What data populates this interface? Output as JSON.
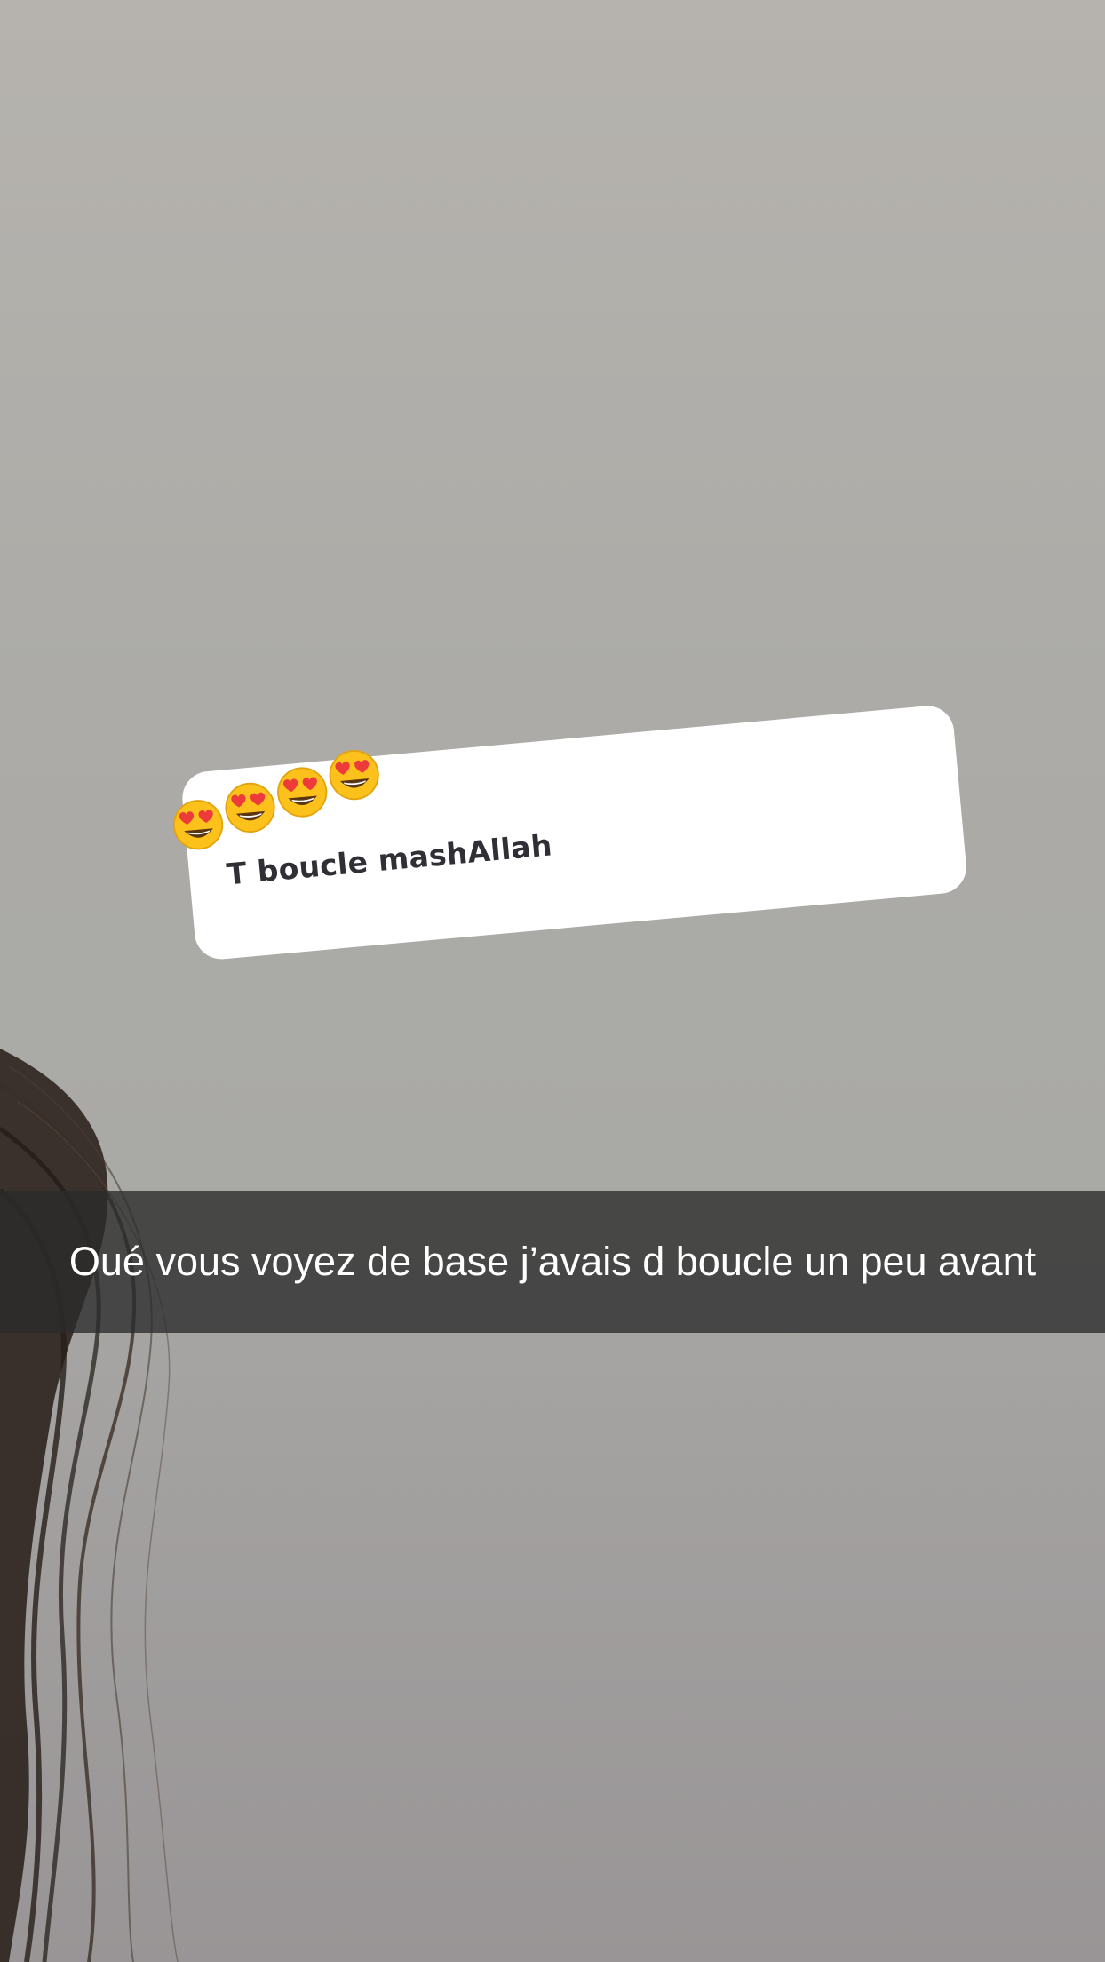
{
  "story": {
    "reply_sticker": {
      "emojis": [
        "heart-eyes-emoji",
        "heart-eyes-emoji",
        "heart-eyes-emoji",
        "heart-eyes-emoji"
      ],
      "text": "T boucle mashAllah"
    },
    "caption": "Oué vous voyez de base j’avais d boucle un peu avant"
  },
  "colors": {
    "sticker_background": "#ffffff",
    "sticker_text": "#2f2f35",
    "caption_bar": "#2b2b2b",
    "caption_text": "#ffffff"
  }
}
